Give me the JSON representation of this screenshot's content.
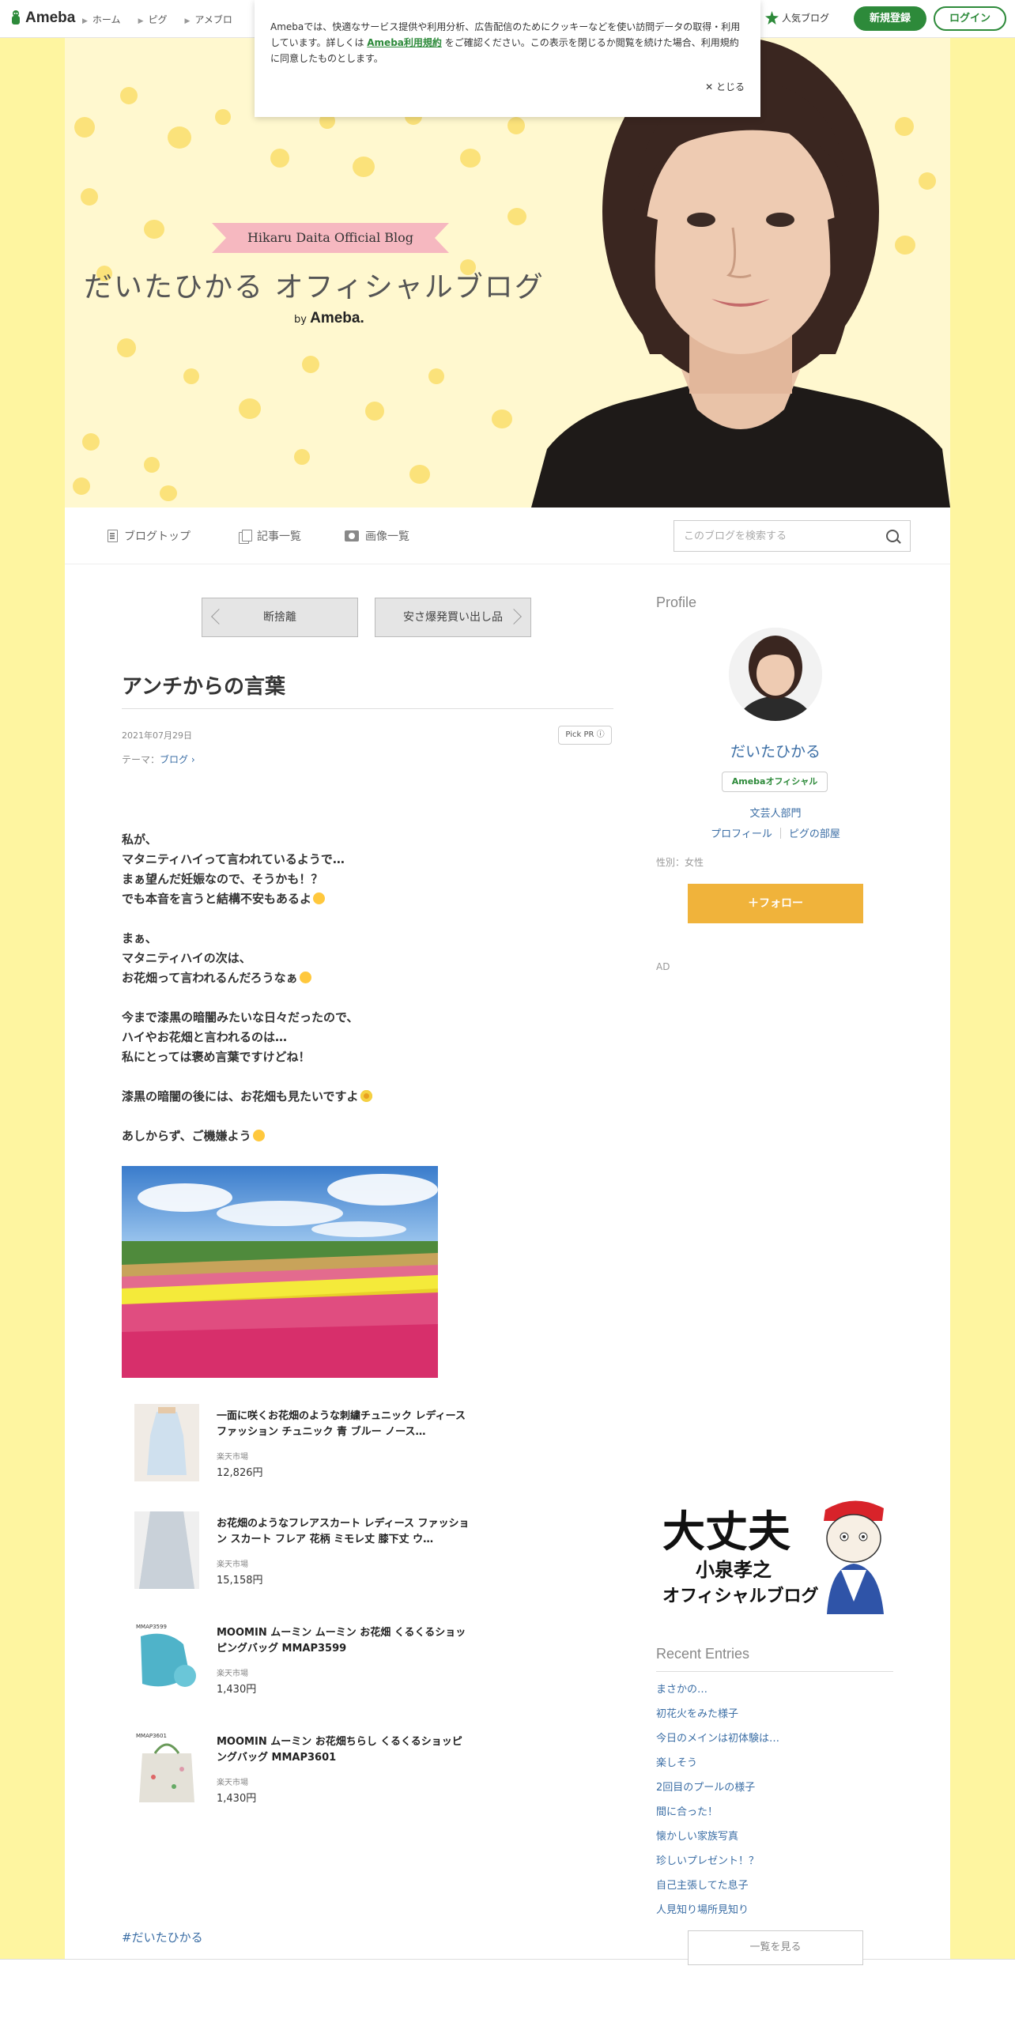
{
  "topbar": {
    "brand": "Ameba",
    "nav": [
      "ホーム",
      "ピグ",
      "アメブロ"
    ],
    "popular": "人気ブログ",
    "signup": "新規登録",
    "login": "ログイン"
  },
  "cookie": {
    "text_before": "Amebaでは、快適なサービス提供や利用分析、広告配信のためにクッキーなどを使い訪問データの取得・利用しています。詳しくは ",
    "link": "Ameba利用規約",
    "text_after": " をご確認ください。この表示を閉じるか閲覧を続けた場合、利用規約に同意したものとします。",
    "close": "✕ とじる"
  },
  "header": {
    "ribbon": "Hikaru Daita Official Blog",
    "title": "だいたひかる オフィシャルブログ",
    "by": "by",
    "brand": "Ameba."
  },
  "blognav": {
    "items": [
      "ブログトップ",
      "記事一覧",
      "画像一覧"
    ],
    "search_placeholder": "このブログを検索する"
  },
  "pager": {
    "prev": "断捨離",
    "next": "安さ爆発買い出し品"
  },
  "article": {
    "title": "アンチからの言葉",
    "date": "2021年07月29日",
    "pickpr": "Pick PR ⓘ",
    "theme_label": "テーマ：",
    "theme_link": "ブログ ›",
    "paragraphs": [
      [
        "私が、",
        "マタニティハイって言われているようで…",
        "まぁ望んだ妊娠なので、そうかも！？",
        "でも本音を言うと結構不安もあるよ"
      ],
      [
        "まぁ、",
        "マタニティハイの次は、",
        "お花畑って言われるんだろうなぁ"
      ],
      [
        "今まで漆黒の暗闇みたいな日々だったので、",
        "ハイやお花畑と言われるのは…",
        "私にとっては褒め言葉ですけどね！"
      ],
      [
        "漆黒の暗闇の後には、お花畑も見たいですよ"
      ],
      [
        "あしからず、ご機嫌よう"
      ]
    ],
    "hashtag": "#だいたひかる"
  },
  "products": [
    {
      "name": "一面に咲くお花畑のような刺繍チュニック レディース ファッション チュニック 青 ブルー ノース…",
      "shop": "楽天市場",
      "price": "12,826円"
    },
    {
      "name": "お花畑のようなフレアスカート レディース ファッション スカート フレア 花柄 ミモレ丈 膝下丈 ウ…",
      "shop": "楽天市場",
      "price": "15,158円"
    },
    {
      "name": "MOOMIN ムーミン ムーミン お花畑 くるくるショッピングバッグ MMAP3599",
      "shop": "楽天市場",
      "price": "1,430円",
      "tag": "MMAP3599"
    },
    {
      "name": "MOOMIN ムーミン お花畑ちらし くるくるショッピングバッグ MMAP3601",
      "shop": "楽天市場",
      "price": "1,430円",
      "tag": "MMAP3601"
    }
  ],
  "sidebar": {
    "profile_heading": "Profile",
    "name": "だいたひかる",
    "badge": "Amebaオフィシャル",
    "category": "文芸人部門",
    "link_profile": "プロフィール",
    "link_pig": "ピグの部屋",
    "gender": "性別：女性",
    "follow": "＋フォロー",
    "ad": "AD",
    "banner_line1": "大丈夫",
    "banner_line2": "小泉孝之",
    "banner_line3": "オフィシャルブログ",
    "recent_heading": "Recent Entries",
    "recent": [
      "まさかの…",
      "初花火をみた様子",
      "今日のメインは初体験は…",
      "楽しそう",
      "2回目のプールの様子",
      "間に合った！",
      "懐かしい家族写真",
      "珍しいプレゼント！？",
      "自己主張してた息子",
      "人見知り場所見知り"
    ],
    "see_all": "一覧を見る"
  },
  "colors": {
    "brand_green": "#2d8a3a",
    "follow_orange": "#f0b33b",
    "link_blue": "#3b6ea5",
    "background_yellow": "#fef5a0"
  }
}
